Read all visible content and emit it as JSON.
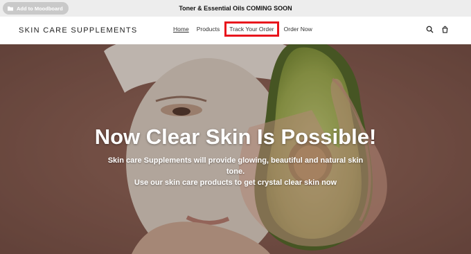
{
  "announcement": {
    "text": "Toner & Essential Oils COMING SOON"
  },
  "moodboard": {
    "label": "Add to Moodboard"
  },
  "brand": {
    "name": "SKIN CARE SUPPLEMENTS"
  },
  "nav": {
    "items": [
      {
        "label": "Home"
      },
      {
        "label": "Products"
      },
      {
        "label": "Track Your Order"
      },
      {
        "label": "Order Now"
      }
    ]
  },
  "hero": {
    "title": "Now Clear Skin Is Possible!",
    "subtitle_lines": [
      "Skin care Supplements will provide glowing, beautiful and natural skin",
      "tone.",
      "Use our skin care products to get crystal clear skin now"
    ]
  },
  "colors": {
    "highlight": "#e8141c",
    "announcement_bg": "#ededed",
    "hero_bg": "#7e5a4f"
  }
}
